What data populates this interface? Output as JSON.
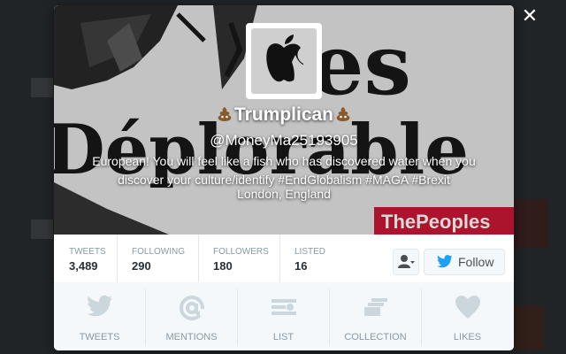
{
  "profile": {
    "name": "Trumplican",
    "handle": "@MoneyMa25193905",
    "bio": "European! You will feel like a fish who has discovered water when you discover your culture/identify #EndGlobalism #MAGA #Brexit",
    "location": "London, England",
    "banner_text": [
      "es",
      "Déplorable"
    ],
    "banner_sign": "ThePeoples"
  },
  "stats": [
    {
      "label": "TWEETS",
      "value": "3,489"
    },
    {
      "label": "FOLLOWING",
      "value": "290"
    },
    {
      "label": "FOLLOWERS",
      "value": "180"
    },
    {
      "label": "LISTED",
      "value": "16"
    }
  ],
  "actions": {
    "follow_label": "Follow",
    "user_actions_icon": "person-dropdown-icon",
    "close_icon": "close-icon"
  },
  "tabs": [
    {
      "label": "TWEETS",
      "icon": "bird-icon"
    },
    {
      "label": "MENTIONS",
      "icon": "at-icon"
    },
    {
      "label": "LIST",
      "icon": "list-icon"
    },
    {
      "label": "COLLECTION",
      "icon": "collection-icon"
    },
    {
      "label": "LIKES",
      "icon": "heart-icon"
    }
  ],
  "colors": {
    "brand": "#1da1f2",
    "sign_red": "#c8102e"
  }
}
